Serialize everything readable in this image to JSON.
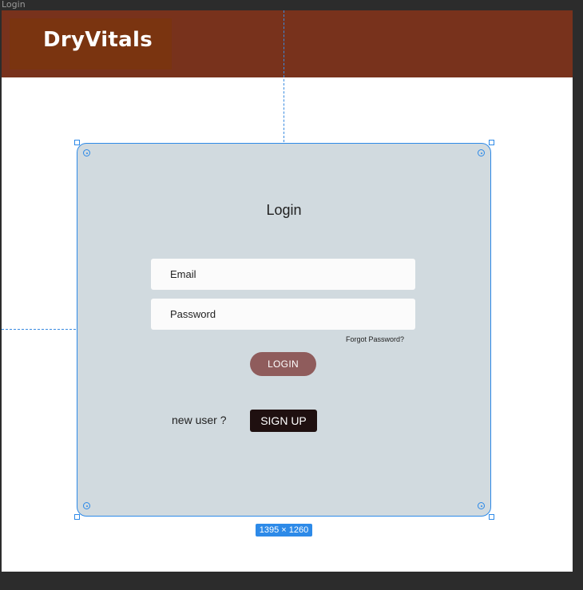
{
  "frame": {
    "label": "Login"
  },
  "header": {
    "logo": "DryVitals"
  },
  "login_card": {
    "title": "Login",
    "email_placeholder": "Email",
    "password_placeholder": "Password",
    "forgot_password": "Forgot Password?",
    "login_button": "LOGIN",
    "new_user_text": "new user ?",
    "signup_button": "SIGN UP"
  },
  "selection": {
    "size_label": "1395 × 1260"
  },
  "colors": {
    "header_bg": "#78321c",
    "logo_bg": "#7a3410",
    "card_bg": "#d1dadf",
    "login_button_bg": "#8f5c5c",
    "signup_button_bg": "#1f1010",
    "selection_accent": "#2d8ae8"
  }
}
